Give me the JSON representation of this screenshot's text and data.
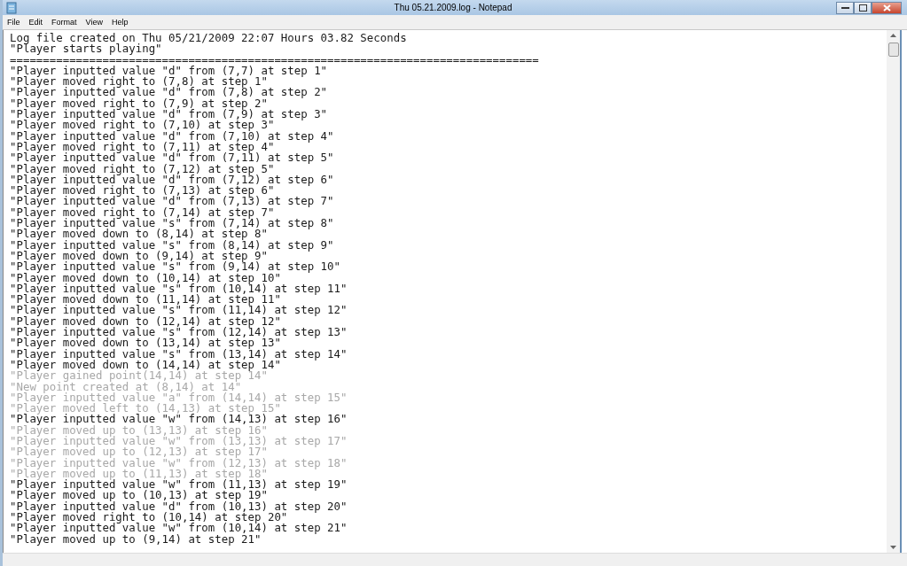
{
  "window": {
    "title": "Thu 05.21.2009.log - Notepad"
  },
  "menu": [
    "File",
    "Edit",
    "Format",
    "View",
    "Help"
  ],
  "lines": [
    {
      "text": "Log file created on Thu 05/21/2009 22:07 Hours 03.82 Seconds",
      "faded": false
    },
    {
      "text": "\"Player starts playing\"",
      "faded": false
    },
    {
      "text": "================================================================================",
      "faded": false
    },
    {
      "text": "\"Player inputted value \"d\" from (7,7) at step 1\"",
      "faded": false
    },
    {
      "text": "\"Player moved right to (7,8) at step 1\"",
      "faded": false
    },
    {
      "text": "\"Player inputted value \"d\" from (7,8) at step 2\"",
      "faded": false
    },
    {
      "text": "\"Player moved right to (7,9) at step 2\"",
      "faded": false
    },
    {
      "text": "\"Player inputted value \"d\" from (7,9) at step 3\"",
      "faded": false
    },
    {
      "text": "\"Player moved right to (7,10) at step 3\"",
      "faded": false
    },
    {
      "text": "\"Player inputted value \"d\" from (7,10) at step 4\"",
      "faded": false
    },
    {
      "text": "\"Player moved right to (7,11) at step 4\"",
      "faded": false
    },
    {
      "text": "\"Player inputted value \"d\" from (7,11) at step 5\"",
      "faded": false
    },
    {
      "text": "\"Player moved right to (7,12) at step 5\"",
      "faded": false
    },
    {
      "text": "\"Player inputted value \"d\" from (7,12) at step 6\"",
      "faded": false
    },
    {
      "text": "\"Player moved right to (7,13) at step 6\"",
      "faded": false
    },
    {
      "text": "\"Player inputted value \"d\" from (7,13) at step 7\"",
      "faded": false
    },
    {
      "text": "\"Player moved right to (7,14) at step 7\"",
      "faded": false
    },
    {
      "text": "\"Player inputted value \"s\" from (7,14) at step 8\"",
      "faded": false
    },
    {
      "text": "\"Player moved down to (8,14) at step 8\"",
      "faded": false
    },
    {
      "text": "\"Player inputted value \"s\" from (8,14) at step 9\"",
      "faded": false
    },
    {
      "text": "\"Player moved down to (9,14) at step 9\"",
      "faded": false
    },
    {
      "text": "\"Player inputted value \"s\" from (9,14) at step 10\"",
      "faded": false
    },
    {
      "text": "\"Player moved down to (10,14) at step 10\"",
      "faded": false
    },
    {
      "text": "\"Player inputted value \"s\" from (10,14) at step 11\"",
      "faded": false
    },
    {
      "text": "\"Player moved down to (11,14) at step 11\"",
      "faded": false
    },
    {
      "text": "\"Player inputted value \"s\" from (11,14) at step 12\"",
      "faded": false
    },
    {
      "text": "\"Player moved down to (12,14) at step 12\"",
      "faded": false
    },
    {
      "text": "\"Player inputted value \"s\" from (12,14) at step 13\"",
      "faded": false
    },
    {
      "text": "\"Player moved down to (13,14) at step 13\"",
      "faded": false
    },
    {
      "text": "\"Player inputted value \"s\" from (13,14) at step 14\"",
      "faded": false
    },
    {
      "text": "\"Player moved down to (14,14) at step 14\"",
      "faded": false
    },
    {
      "text": "\"Player gained point(14,14) at step 14\"",
      "faded": true
    },
    {
      "text": "\"New point created at (8,14) at 14\"",
      "faded": true
    },
    {
      "text": "\"Player inputted value \"a\" from (14,14) at step 15\"",
      "faded": true
    },
    {
      "text": "\"Player moved left to (14,13) at step 15\"",
      "faded": true
    },
    {
      "text": "\"Player inputted value \"w\" from (14,13) at step 16\"",
      "faded": false
    },
    {
      "text": "\"Player moved up to (13,13) at step 16\"",
      "faded": true
    },
    {
      "text": "\"Player inputted value \"w\" from (13,13) at step 17\"",
      "faded": true
    },
    {
      "text": "\"Player moved up to (12,13) at step 17\"",
      "faded": true
    },
    {
      "text": "\"Player inputted value \"w\" from (12,13) at step 18\"",
      "faded": true
    },
    {
      "text": "\"Player moved up to (11,13) at step 18\"",
      "faded": true
    },
    {
      "text": "\"Player inputted value \"w\" from (11,13) at step 19\"",
      "faded": false
    },
    {
      "text": "\"Player moved up to (10,13) at step 19\"",
      "faded": false
    },
    {
      "text": "\"Player inputted value \"d\" from (10,13) at step 20\"",
      "faded": false
    },
    {
      "text": "\"Player moved right to (10,14) at step 20\"",
      "faded": false
    },
    {
      "text": "\"Player inputted value \"w\" from (10,14) at step 21\"",
      "faded": false
    },
    {
      "text": "\"Player moved up to (9,14) at step 21\"",
      "faded": false
    }
  ]
}
